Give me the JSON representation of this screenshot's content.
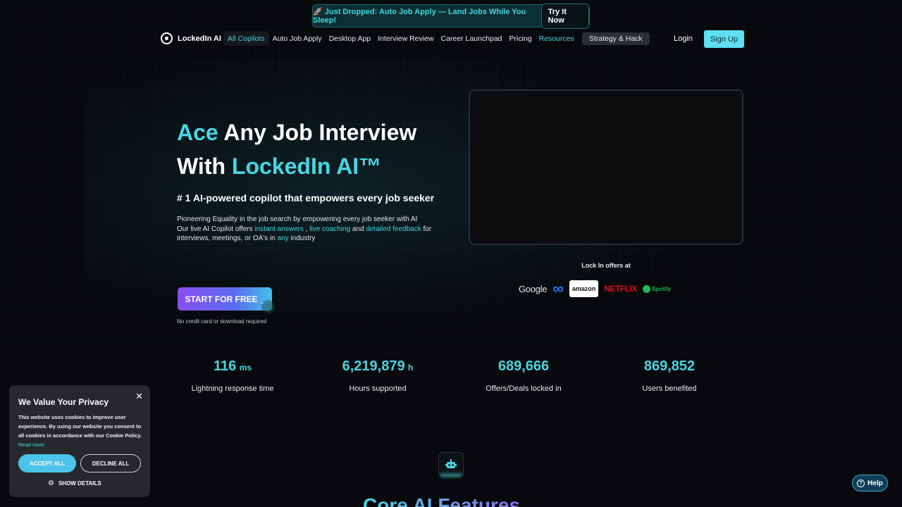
{
  "announcement": {
    "text": "🚀 Just Dropped: Auto Job Apply — Land Jobs While You Sleep!",
    "button": "Try It Now",
    "accent": "#47d6e3"
  },
  "nav": {
    "brand": "LockedIn AI",
    "links": [
      "All Copilots",
      "Auto Job Apply",
      "Desktop App",
      "Interview Review",
      "Career Launchpad",
      "Pricing",
      "Resources",
      "Strategy & Hack"
    ],
    "login": "Login",
    "signup": "Sign Up"
  },
  "hero": {
    "title_line1_accent": "Ace",
    "title_line1_rest": " Any Job Interview",
    "title_line2_start": "With ",
    "title_line2_accent": "LockedIn AI™",
    "tagline_start": "# 1 AI-powered copilot that ",
    "tagline_bold": "empowers",
    "tagline_end": " every job seeker",
    "desc_line1": "Pioneering Equality in the job search by empowering every job seeker with AI",
    "desc_l2_a": "Our live AI Copilot offers ",
    "desc_l2_h1": "instant answers",
    "desc_l2_b": " , ",
    "desc_l2_h2": "live coaching",
    "desc_l2_c": " and ",
    "desc_l2_h3": "detailed feedback",
    "desc_l2_d": " for",
    "desc_l3_a": "interviews, meetings, or OA's in ",
    "desc_l3_h": "any",
    "desc_l3_b": " industry",
    "cta": "START FOR FREE _",
    "cta_note": "No credit card or download required"
  },
  "offers": {
    "title": "Lock In offers at",
    "logos": [
      "Google",
      "∞",
      "amazon",
      "NETFLIX",
      "Spotify"
    ]
  },
  "stats": [
    {
      "value": "116",
      "unit": "ms",
      "label": "Lightning response time"
    },
    {
      "value": "6,219,879",
      "unit": "h",
      "label": "Hours supported"
    },
    {
      "value": "689,666",
      "unit": "",
      "label": "Offers/Deals locked in"
    },
    {
      "value": "869,852",
      "unit": "",
      "label": "Users benefited"
    }
  ],
  "section": {
    "title": "Core AI Features"
  },
  "cookie": {
    "title": "We Value Your Privacy",
    "body": "This website uses cookies to improve user experience. By using our website you consent to all cookies in accordance with our Cookie Policy.",
    "read_more": "Read more",
    "accept": "ACCEPT ALL",
    "decline": "DECLINE ALL",
    "details": "SHOW DETAILS",
    "close": "✕"
  },
  "help": {
    "label": "Help"
  }
}
